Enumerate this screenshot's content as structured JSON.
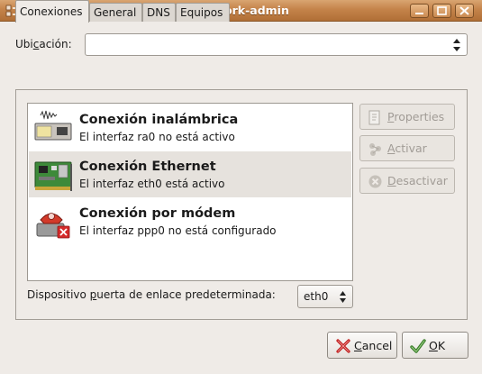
{
  "window": {
    "title": "network-admin"
  },
  "location": {
    "label_pre": "Ubi",
    "label_key": "c",
    "label_post": "ación:",
    "value": ""
  },
  "tabs": [
    {
      "label": "Conexiones",
      "active": true
    },
    {
      "label": "General",
      "active": false
    },
    {
      "label": "DNS",
      "active": false
    },
    {
      "label": "Equipos",
      "active": false
    }
  ],
  "connections": [
    {
      "name": "Conexión inalámbrica",
      "status": "El interfaz ra0 no está activo",
      "icon": "wireless-card-icon",
      "selected": false
    },
    {
      "name": "Conexión Ethernet",
      "status": "El interfaz eth0 está activo",
      "icon": "ethernet-card-icon",
      "selected": true
    },
    {
      "name": "Conexión por módem",
      "status": "El interfaz ppp0 no está configurado",
      "icon": "modem-phone-icon",
      "selected": false
    }
  ],
  "side_buttons": {
    "properties": {
      "pre": "",
      "key": "P",
      "post": "roperties",
      "icon": "properties-icon"
    },
    "activate": {
      "pre": "",
      "key": "A",
      "post": "ctivar",
      "icon": "activate-icon"
    },
    "deactivate": {
      "pre": "",
      "key": "D",
      "post": "esactivar",
      "icon": "deactivate-icon"
    }
  },
  "gateway": {
    "label_pre": "Dispositivo ",
    "label_key": "p",
    "label_post": "uerta de enlace predeterminada:",
    "value": "eth0"
  },
  "footer": {
    "cancel": {
      "pre": "",
      "key": "C",
      "post": "ancel",
      "icon": "cancel-icon"
    },
    "ok": {
      "pre": "",
      "key": "O",
      "post": "K",
      "icon": "ok-icon"
    }
  },
  "colors": {
    "titlebar": "#c4834a",
    "selected_row": "#e6e2dd",
    "cancel_red": "#c01b1b",
    "ok_green": "#3a7d2a"
  }
}
